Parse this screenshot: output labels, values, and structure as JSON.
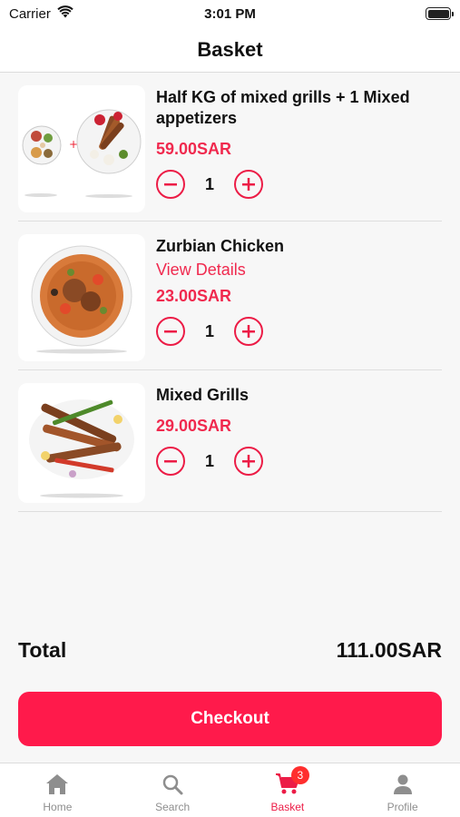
{
  "status_bar": {
    "carrier": "Carrier",
    "time": "3:01 PM"
  },
  "header": {
    "title": "Basket"
  },
  "items": [
    {
      "name": "Half KG of mixed grills + 1 Mixed appetizers",
      "details_link": "",
      "price": "59.00SAR",
      "quantity": "1"
    },
    {
      "name": "Zurbian Chicken",
      "details_link": "View Details",
      "price": "23.00SAR",
      "quantity": "1"
    },
    {
      "name": "Mixed Grills",
      "details_link": "",
      "price": "29.00SAR",
      "quantity": "1"
    }
  ],
  "summary": {
    "total_label": "Total",
    "total_value": "111.00SAR"
  },
  "checkout": {
    "label": "Checkout"
  },
  "tab_bar": {
    "tabs": [
      {
        "label": "Home",
        "icon": "home-icon",
        "active": false
      },
      {
        "label": "Search",
        "icon": "search-icon",
        "active": false
      },
      {
        "label": "Basket",
        "icon": "cart-icon",
        "active": true,
        "badge": "3"
      },
      {
        "label": "Profile",
        "icon": "person-icon",
        "active": false
      }
    ]
  },
  "colors": {
    "accent": "#ec1c46",
    "checkout_bg": "#ff1a4b",
    "badge": "#ff2e2e",
    "inactive_tab": "#8e8e8e"
  }
}
